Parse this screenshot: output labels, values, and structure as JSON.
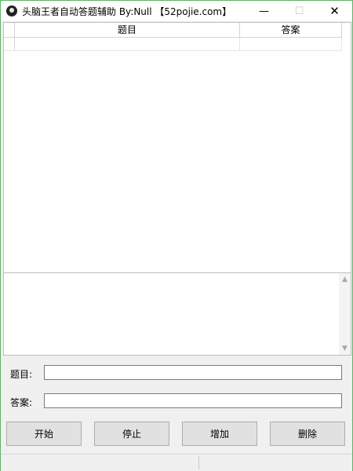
{
  "window": {
    "title": "头脑王者自动答题辅助  By:Null  【52pojie.com】"
  },
  "caption_buttons": {
    "minimize_icon": "minimize-icon",
    "maximize_icon": "maximize-icon",
    "close_icon": "close-icon"
  },
  "table": {
    "columns": [
      "题目",
      "答案"
    ],
    "rows": [
      [
        "",
        ""
      ]
    ]
  },
  "log": {
    "text": ""
  },
  "form": {
    "question_label": "题目:",
    "question_value": "",
    "answer_label": "答案:",
    "answer_value": ""
  },
  "buttons": {
    "start": "开始",
    "stop": "停止",
    "add": "增加",
    "delete": "删除"
  },
  "colors": {
    "window_border": "#5fb36b",
    "button_face": "#e1e1e1"
  }
}
